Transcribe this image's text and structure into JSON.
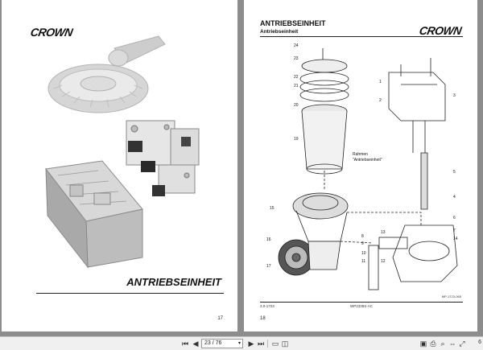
{
  "left_page": {
    "brand": "CROWN",
    "title": "ANTRIEBSEINHEIT",
    "page_number": "17"
  },
  "right_page": {
    "brand": "CROWN",
    "title": "ANTRIEBSEINHEIT",
    "subtitle": "Antriebseinheit",
    "callouts": [
      "24",
      "23",
      "22",
      "21",
      "20",
      "19",
      "15",
      "16",
      "17",
      "1",
      "2",
      "3",
      "4",
      "5",
      "6",
      "7",
      "8",
      "9",
      "10",
      "11",
      "12",
      "13",
      "14"
    ],
    "frame_label_1": "Rahmen",
    "frame_label_2": "\"Antriebseinheit\"",
    "ref_code": "MP-1723-065",
    "footer_left": "3.0-1723",
    "footer_center": "WP2335S-AC",
    "page_number": "18"
  },
  "toolbar": {
    "current_page": "23",
    "page_separator": "/",
    "total_pages": "76",
    "zoom_tail": "6"
  }
}
